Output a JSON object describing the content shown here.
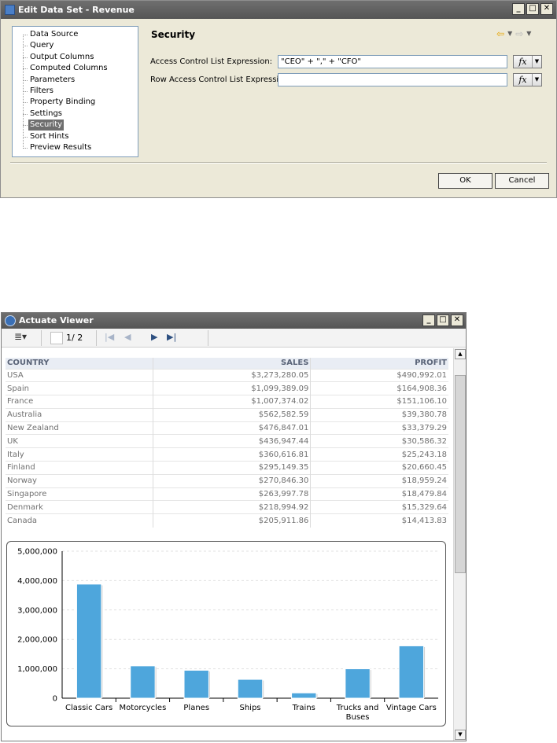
{
  "dialog": {
    "title": "Edit Data Set - Revenue",
    "tree_items": [
      "Data Source",
      "Query",
      "Output Columns",
      "Computed Columns",
      "Parameters",
      "Filters",
      "Property Binding",
      "Settings",
      "Security",
      "Sort Hints",
      "Preview Results"
    ],
    "selected_item": "Security",
    "section_title": "Security",
    "acl_label": "Access Control List Expression:",
    "acl_value": "\"CEO\" + \",\" + \"CFO\"",
    "row_acl_label": "Row Access Control List Expression:",
    "row_acl_value": "",
    "ok_label": "OK",
    "cancel_label": "Cancel",
    "colors": {
      "selected_bg": "#6e6e6e",
      "back_arrow": "#e6a400"
    }
  },
  "viewer": {
    "title": "Actuate Viewer",
    "page_text": "1/ 2",
    "table": {
      "headers": [
        "COUNTRY",
        "SALES",
        "PROFIT"
      ],
      "rows": [
        [
          "USA",
          "$3,273,280.05",
          "$490,992.01"
        ],
        [
          "Spain",
          "$1,099,389.09",
          "$164,908.36"
        ],
        [
          "France",
          "$1,007,374.02",
          "$151,106.10"
        ],
        [
          "Australia",
          "$562,582.59",
          "$39,380.78"
        ],
        [
          "New Zealand",
          "$476,847.01",
          "$33,379.29"
        ],
        [
          "UK",
          "$436,947.44",
          "$30,586.32"
        ],
        [
          "Italy",
          "$360,616.81",
          "$25,243.18"
        ],
        [
          "Finland",
          "$295,149.35",
          "$20,660.45"
        ],
        [
          "Norway",
          "$270,846.30",
          "$18,959.24"
        ],
        [
          "Singapore",
          "$263,997.78",
          "$18,479.84"
        ],
        [
          "Denmark",
          "$218,994.92",
          "$15,329.64"
        ],
        [
          "Canada",
          "$205,911.86",
          "$14,413.83"
        ]
      ]
    }
  },
  "chart_data": {
    "type": "bar",
    "categories": [
      "Classic Cars",
      "Motorcycles",
      "Planes",
      "Ships",
      "Trains",
      "Trucks and\nBuses",
      "Vintage Cars"
    ],
    "values": [
      3880000,
      1100000,
      950000,
      640000,
      180000,
      1000000,
      1780000
    ],
    "ylim": [
      0,
      5000000
    ],
    "yticks": [
      "0",
      "1,000,000",
      "2,000,000",
      "3,000,000",
      "4,000,000",
      "5,000,000"
    ],
    "grid": true,
    "bar_color": "#4ea6dc"
  }
}
